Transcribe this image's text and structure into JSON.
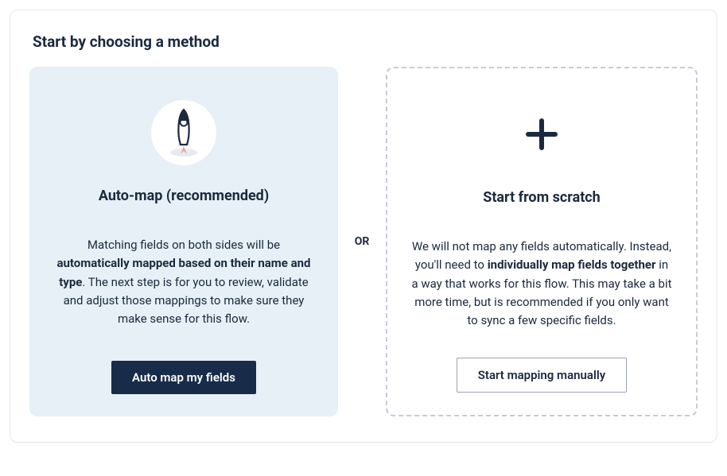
{
  "heading": "Start by choosing a method",
  "divider": "OR",
  "left": {
    "title": "Auto-map (recommended)",
    "desc_pre": "Matching fields on both sides will be ",
    "desc_bold": "automatically mapped based on their name and type",
    "desc_post": ". The next step is for you to review, validate and adjust those mappings to make sure they make sense for this flow.",
    "button": "Auto map my fields"
  },
  "right": {
    "title": "Start from scratch",
    "desc_pre": "We will not map any fields automatically. Instead, you'll need to ",
    "desc_bold": "individually map fields together",
    "desc_post": " in a way that works for this flow. This may take a bit more time, but is recommended if you only want to sync a few specific fields.",
    "button": "Start mapping manually"
  }
}
